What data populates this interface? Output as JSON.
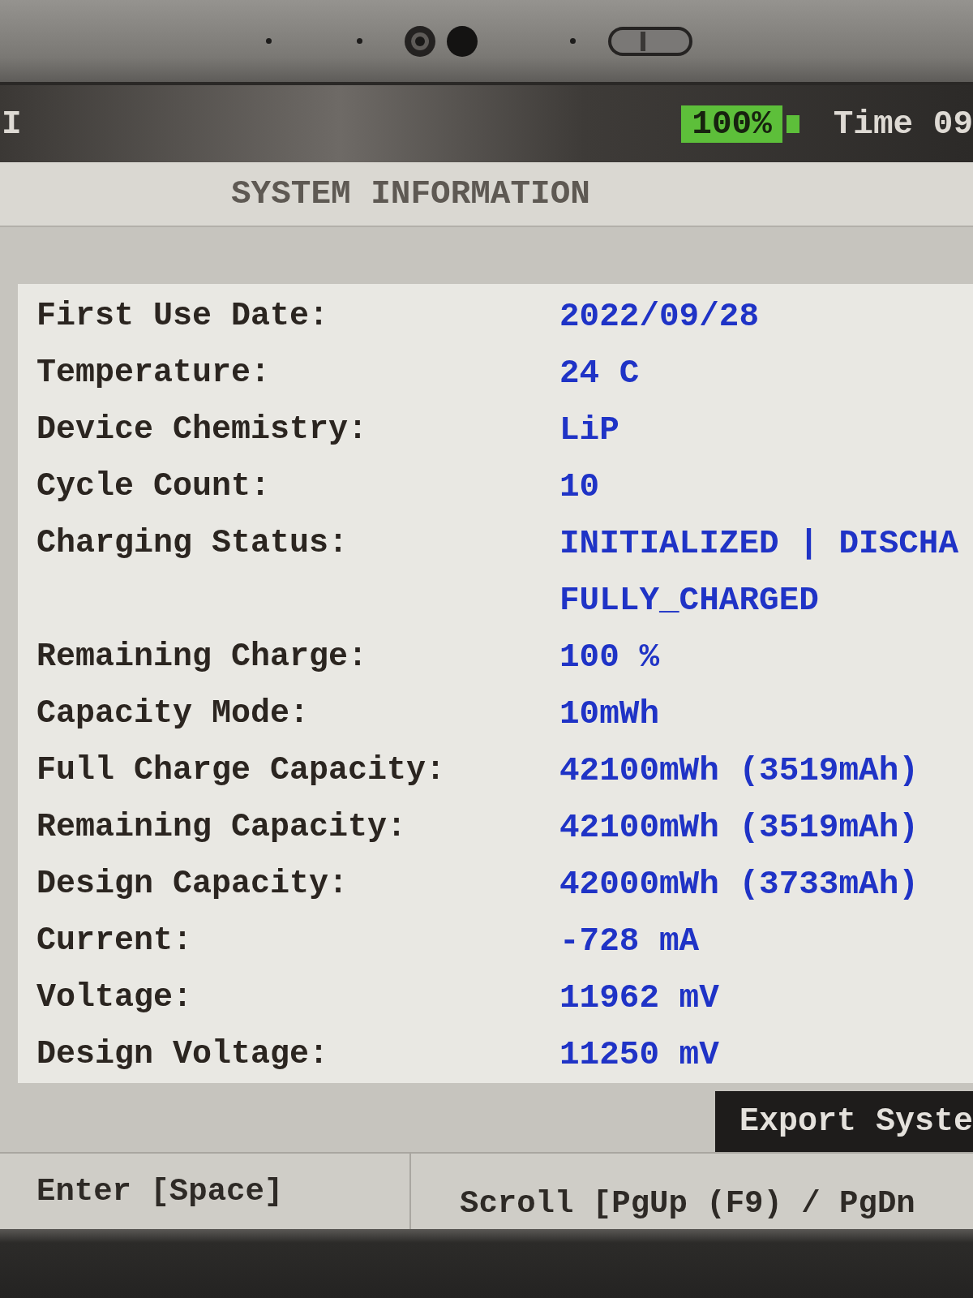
{
  "top_bar": {
    "title_fragment": "I",
    "battery_reading": "100%",
    "time": "Time 09"
  },
  "title": "SYSTEM INFORMATION",
  "fields": [
    {
      "label": "First Use Date:",
      "values": [
        "2022/09/28"
      ]
    },
    {
      "label": "Temperature:",
      "values": [
        "24 C"
      ]
    },
    {
      "label": "Device Chemistry:",
      "values": [
        "LiP"
      ]
    },
    {
      "label": "Cycle Count:",
      "values": [
        "10"
      ]
    },
    {
      "label": "Charging Status:",
      "values": [
        "INITIALIZED | DISCHA",
        "FULLY_CHARGED"
      ]
    },
    {
      "label": "Remaining Charge:",
      "values": [
        "100 %"
      ]
    },
    {
      "label": "Capacity Mode:",
      "values": [
        "10mWh"
      ]
    },
    {
      "label": "Full Charge Capacity:",
      "values": [
        "42100mWh (3519mAh)"
      ]
    },
    {
      "label": "Remaining Capacity:",
      "values": [
        "42100mWh (3519mAh)"
      ]
    },
    {
      "label": "Design Capacity:",
      "values": [
        "42000mWh (3733mAh)"
      ]
    },
    {
      "label": "Current:",
      "values": [
        "-728 mA"
      ]
    },
    {
      "label": "Voltage:",
      "values": [
        "11962 mV"
      ]
    },
    {
      "label": "Design Voltage:",
      "values": [
        "11250 mV"
      ]
    }
  ],
  "export_button": "Export Syste",
  "footer_hints": [
    "Enter [Space]",
    "Scroll [PgUp (F9) / PgDn"
  ]
}
